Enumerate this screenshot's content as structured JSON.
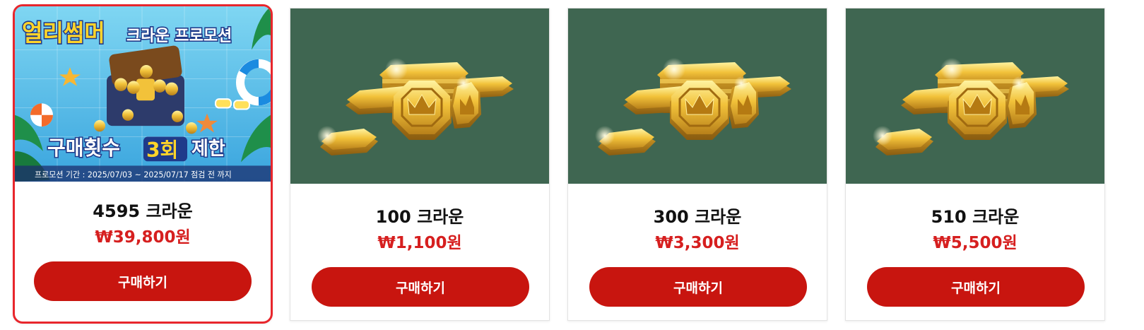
{
  "colors": {
    "accent": "#c8150f",
    "price": "#d61f1f",
    "selected_border": "#e8262c",
    "thumb_bg": "#3f6651"
  },
  "products": [
    {
      "name": "4595 크라운",
      "price": "₩39,800원",
      "button": "구매하기",
      "selected": true,
      "image": "promo-banner",
      "banner": {
        "title_part1": "얼리썸머",
        "title_part2": "크라운 프로모션",
        "limit_prefix": "구매횟수",
        "limit_count": "3회",
        "limit_suffix": "제한",
        "period": "프로모션 기간 : 2025/07/03 ~ 2025/07/17 점검 전 까지"
      }
    },
    {
      "name": "100 크라운",
      "price": "₩1,100원",
      "button": "구매하기",
      "selected": false,
      "image": "crown-coins"
    },
    {
      "name": "300 크라운",
      "price": "₩3,300원",
      "button": "구매하기",
      "selected": false,
      "image": "crown-coins"
    },
    {
      "name": "510 크라운",
      "price": "₩5,500원",
      "button": "구매하기",
      "selected": false,
      "image": "crown-coins"
    }
  ]
}
